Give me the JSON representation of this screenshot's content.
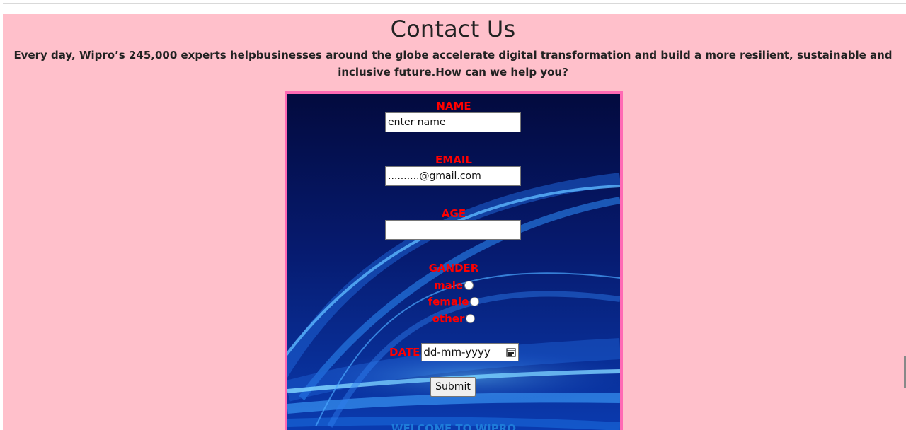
{
  "header": {
    "title": "Contact Us",
    "subtitle": "Every day, Wipro’s 245,000 experts helpbusinesses around the globe accelerate digital transformation and build a more resilient, sustainable and inclusive future.How can we help you?"
  },
  "form": {
    "name": {
      "label": "NAME",
      "value": "enter name"
    },
    "email": {
      "label": "EMAIL",
      "value": "..........@gmail.com"
    },
    "age": {
      "label": "AGE",
      "value": ""
    },
    "gender": {
      "label": "GANDER",
      "options": [
        {
          "label": "male"
        },
        {
          "label": "female"
        },
        {
          "label": "other"
        }
      ]
    },
    "date": {
      "label": "DATE",
      "placeholder": "dd-mm-yyyy"
    },
    "submit_label": "Submit",
    "footer_text": "WELCOME TO WIPRO"
  },
  "colors": {
    "page_background": "#ffc0cb",
    "form_border": "#ff69b4",
    "label_color": "#ff0000",
    "form_background": "#050d4a"
  },
  "icons": {
    "calendar": "calendar-icon"
  }
}
